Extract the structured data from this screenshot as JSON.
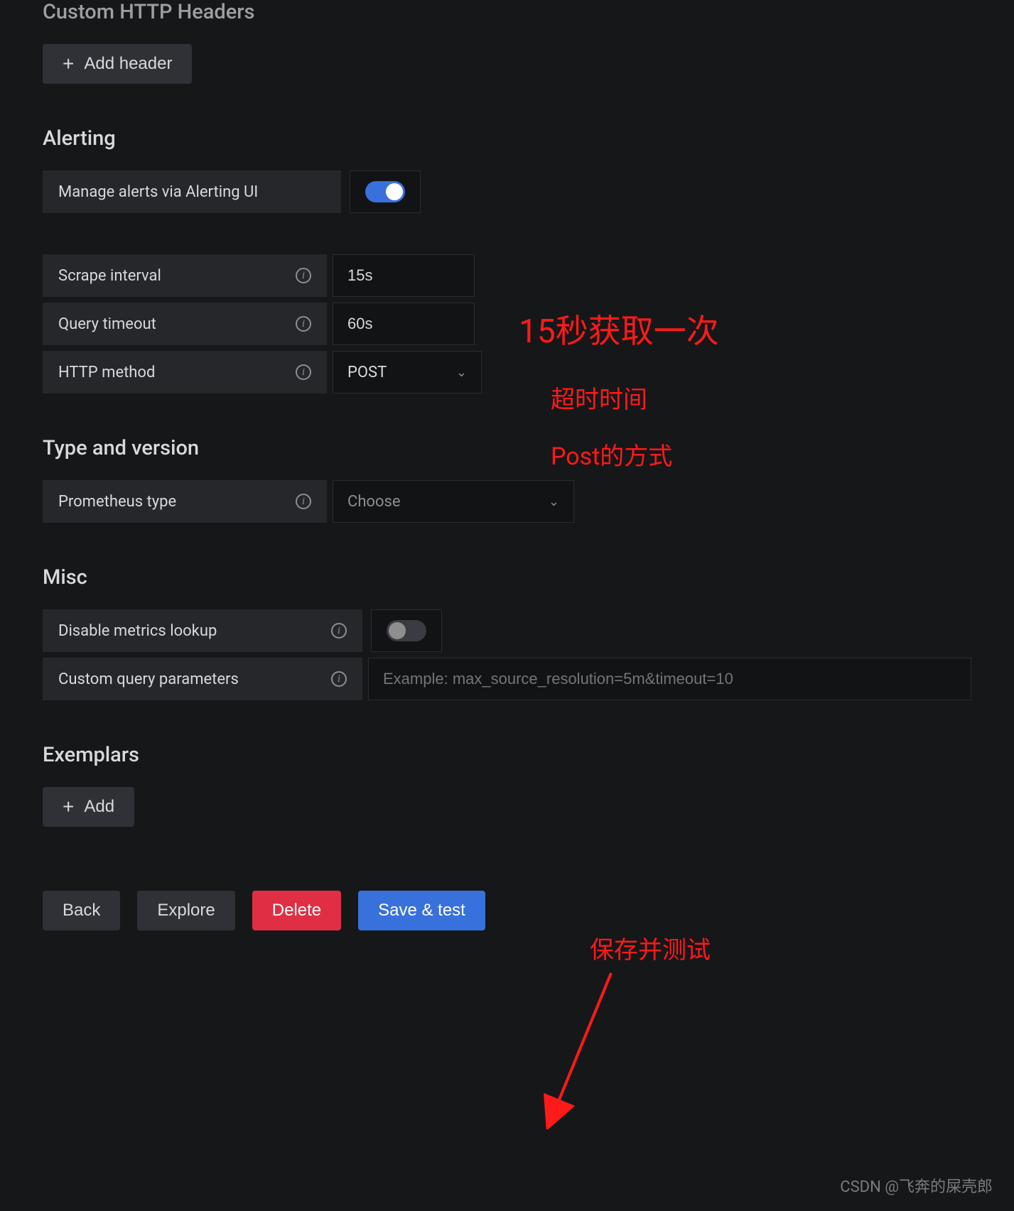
{
  "custom_headers": {
    "title": "Custom HTTP Headers",
    "add_button": "Add header"
  },
  "alerting": {
    "title": "Alerting",
    "manage_label": "Manage alerts via Alerting UI",
    "toggle_on": true,
    "scrape_label": "Scrape interval",
    "scrape_value": "15s",
    "timeout_label": "Query timeout",
    "timeout_value": "60s",
    "method_label": "HTTP method",
    "method_value": "POST"
  },
  "typever": {
    "title": "Type and version",
    "type_label": "Prometheus type",
    "type_placeholder": "Choose"
  },
  "misc": {
    "title": "Misc",
    "disable_lookup_label": "Disable metrics lookup",
    "custom_query_label": "Custom query parameters",
    "custom_query_placeholder": "Example: max_source_resolution=5m&timeout=10"
  },
  "exemplars": {
    "title": "Exemplars",
    "add_button": "Add"
  },
  "buttons": {
    "back": "Back",
    "explore": "Explore",
    "delete": "Delete",
    "save": "Save & test"
  },
  "annotations": {
    "scrape": "15秒获取一次",
    "timeout": "超时时间",
    "method": "Post的方式",
    "save": "保存并测试"
  },
  "watermark": "CSDN @飞奔的屎壳郎"
}
